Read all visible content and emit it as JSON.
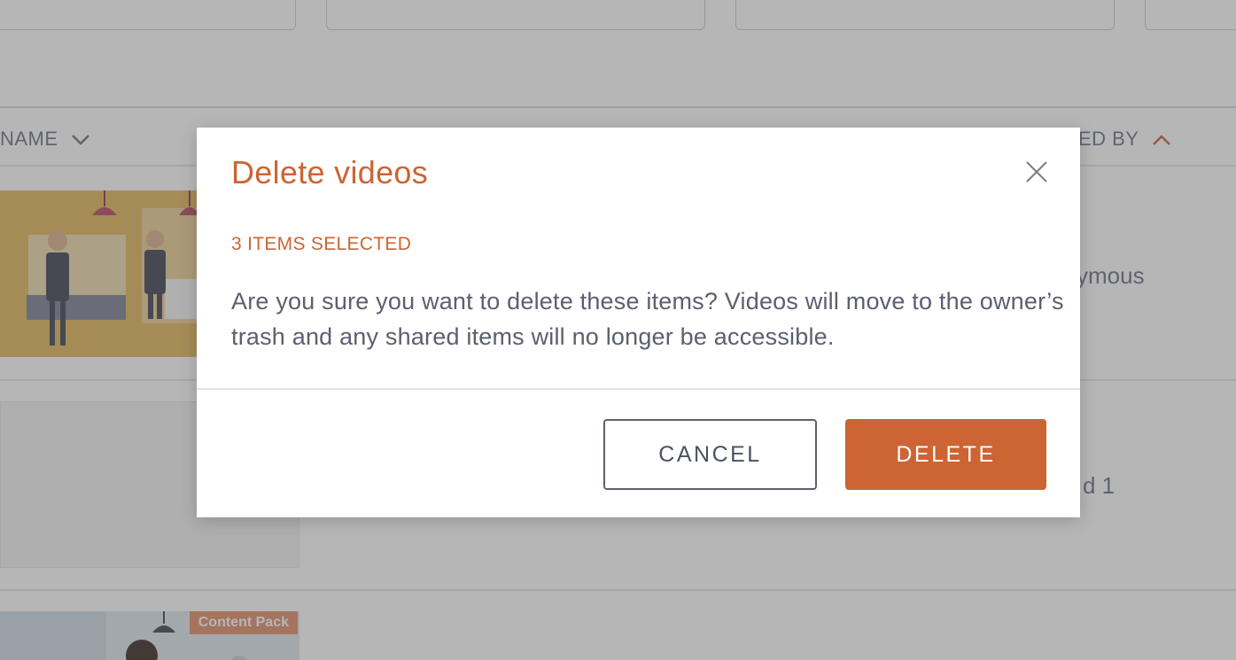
{
  "background": {
    "columns": {
      "name_label": "NAME",
      "created_by_label": "TED BY"
    },
    "rows": [
      {
        "created_by": "ymous"
      },
      {
        "created_by": "d 1"
      },
      {
        "badge": "Content Pack"
      }
    ]
  },
  "modal": {
    "title": "Delete videos",
    "selected_count": "3 ITEMS SELECTED",
    "message": "Are you sure you want to delete these items? Videos will move to the owner’s trash and any shared items will no longer be accessible.",
    "cancel_label": "CANCEL",
    "delete_label": "DELETE"
  },
  "colors": {
    "accent": "#cc6434",
    "text": "#5b6070",
    "overlay": "rgba(80,80,84,0.42)"
  },
  "icons": {
    "close": "close-icon",
    "sort_name": "chevron-down-icon",
    "sort_created": "chevron-up-icon"
  }
}
